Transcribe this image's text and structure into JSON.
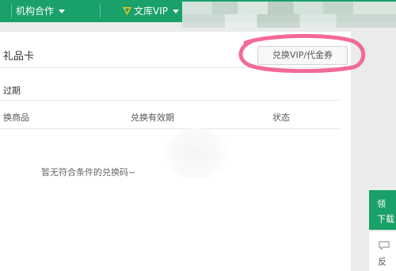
{
  "topbar": {
    "partner_label": "机构合作",
    "vip_label": "文库VIP"
  },
  "panel": {
    "title": "礼品卡",
    "redeem_button": "兑换VIP/代金券",
    "filter_label": "过期",
    "columns": [
      "换商品",
      "兑换有效期",
      "状态"
    ],
    "empty_message": "暂无符合条件的兑换码~"
  },
  "side": {
    "card_line_1": "领",
    "card_line_2": "下载",
    "feedback_label": "反"
  },
  "colors": {
    "brand_green": "#1aa069",
    "annotation_pink": "#f2699a"
  },
  "icons": [
    "chevron-down-icon",
    "vip-diamond-icon",
    "chat-bubble-icon"
  ]
}
